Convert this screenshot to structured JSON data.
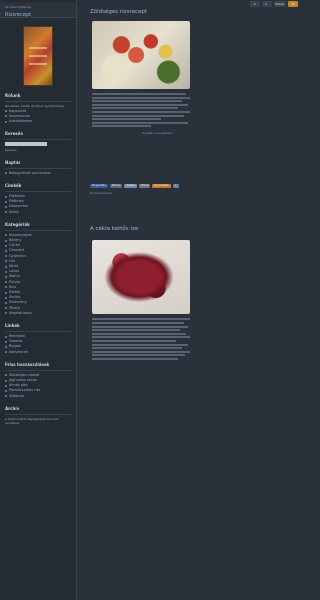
{
  "header": {
    "site_subtitle": "Az oldal tartalma",
    "site_name": "Rizsrecept"
  },
  "topbar": {
    "buttons": [
      "◂",
      "▸",
      "Belép",
      "✉"
    ]
  },
  "sidebar": {
    "sections": [
      {
        "title": "Rólunk",
        "text": "Receptek, ételek és italok gyűjteménye.",
        "items": [
          "Kapcsolat",
          "Impresszum",
          "Adatvédelem"
        ]
      },
      {
        "title": "Keresés",
        "search_placeholder": "",
        "link": "Keresés"
      },
      {
        "title": "Naptár",
        "items": [
          "Bejegyzések archívuma"
        ]
      },
      {
        "title": "Címkék",
        "items": [
          "Előételek",
          "Főételek",
          "Desszertek",
          "Italok"
        ]
      },
      {
        "title": "Kategóriák",
        "items": [
          "Alapanyagok",
          "Bárány",
          "Csirke",
          "Desszert",
          "Gyümölcs",
          "Hal",
          "Köret",
          "Leves",
          "Marha",
          "Pulyka",
          "Rizs",
          "Saláta",
          "Sertés",
          "Sütemény",
          "Tészta",
          "Vegetáriánus"
        ]
      },
      {
        "title": "Linkek",
        "items": [
          "Receptek",
          "Gasztro",
          "Blogok",
          "Kedvencek"
        ]
      },
      {
        "title": "Friss hozzászólások",
        "items": [
          "Zöldséges rizottó",
          "Joghurtos csirke",
          "Almás pite",
          "Paradicsomos rizs",
          "Tejberizs"
        ]
      },
      {
        "title": "Archív",
        "text": "A blog korábbi bejegyzései havonta rendezve."
      }
    ]
  },
  "posts": [
    {
      "title": "Zöldséges rizsrecept",
      "meta": "",
      "read_more": "Tovább a recepthez »",
      "comments": "Hozzászólások"
    },
    {
      "title": "A cékla kettős íze",
      "meta": ""
    }
  ],
  "share": {
    "buttons": [
      {
        "label": "Megosztás",
        "color": "#3b5998"
      },
      {
        "label": "Tetszik",
        "color": "#5d6a7a"
      },
      {
        "label": "Twitter",
        "color": "#6b8db3"
      },
      {
        "label": "Email",
        "color": "#777777"
      },
      {
        "label": "Nyomtatás",
        "color": "#c8792f"
      },
      {
        "label": "+",
        "color": "#5b7fae"
      }
    ]
  }
}
